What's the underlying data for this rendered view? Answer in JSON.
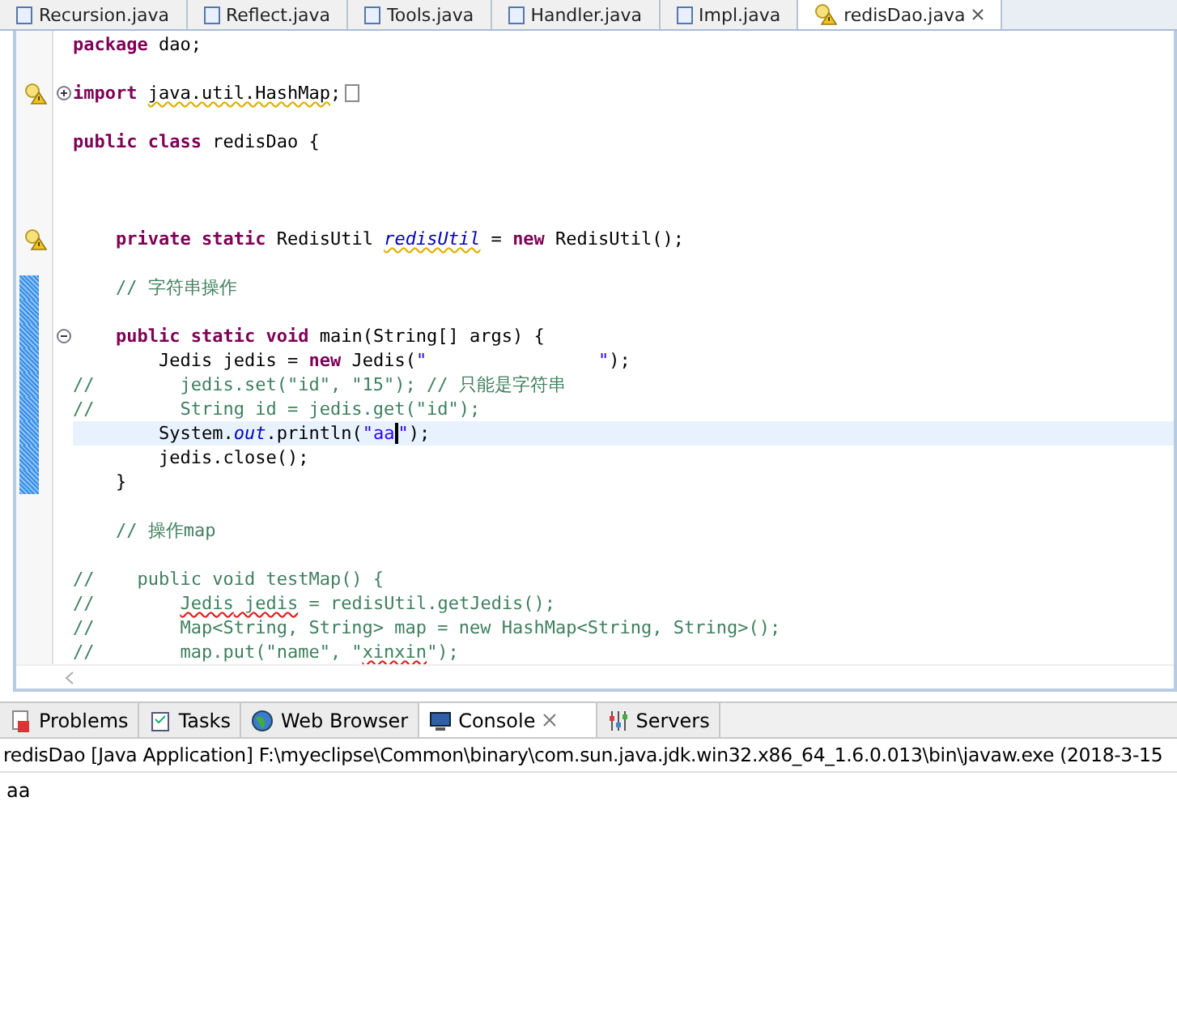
{
  "editor_tabs": [
    {
      "label": "Recursion.java",
      "selected": false,
      "warning": false
    },
    {
      "label": "Reflect.java",
      "selected": false,
      "warning": false
    },
    {
      "label": "Tools.java",
      "selected": false,
      "warning": false
    },
    {
      "label": "Handler.java",
      "selected": false,
      "warning": false
    },
    {
      "label": "Impl.java",
      "selected": false,
      "warning": false
    },
    {
      "label": "redisDao.java",
      "selected": true,
      "warning": true
    }
  ],
  "code_lines": [
    {
      "kind": "code",
      "tokens": [
        {
          "kind": "keyword",
          "text": "package"
        },
        {
          "kind": "plain",
          "text": " dao;"
        }
      ]
    },
    {
      "kind": "blank"
    },
    {
      "kind": "code",
      "warning": true,
      "fold_expanded": false,
      "tokens": [
        {
          "kind": "keyword",
          "text": "import "
        },
        {
          "kind": "plain",
          "text": "java.util.HashMap",
          "warning_underline": true
        },
        {
          "kind": "plain",
          "text": ";"
        }
      ]
    },
    {
      "kind": "blank"
    },
    {
      "kind": "code",
      "tokens": [
        {
          "kind": "keyword",
          "text": "public class"
        },
        {
          "kind": "plain",
          "text": " redisDao {"
        }
      ]
    },
    {
      "kind": "blank"
    },
    {
      "kind": "blank"
    },
    {
      "kind": "blank"
    },
    {
      "kind": "code",
      "warning": true,
      "tokens": [
        {
          "kind": "keyword",
          "text": "    private static"
        },
        {
          "kind": "plain",
          "text": " RedisUtil "
        },
        {
          "kind": "field",
          "text": "redisUtil",
          "warning_underline": true
        },
        {
          "kind": "plain",
          "text": " = "
        },
        {
          "kind": "keyword",
          "text": "new"
        },
        {
          "kind": "plain",
          "text": " RedisUtil();"
        }
      ]
    },
    {
      "kind": "blank"
    },
    {
      "kind": "code",
      "changed": true,
      "tokens": [
        {
          "kind": "comment",
          "text": "    // 字符串操作"
        }
      ]
    },
    {
      "kind": "blank",
      "changed": true
    },
    {
      "kind": "code",
      "changed": true,
      "fold_expanded": true,
      "tokens": [
        {
          "kind": "keyword",
          "text": "    public static void"
        },
        {
          "kind": "plain",
          "text": " main(String[] args) {"
        }
      ]
    },
    {
      "kind": "code",
      "changed": true,
      "tokens": [
        {
          "kind": "plain",
          "text": "        Jedis jedis = "
        },
        {
          "kind": "keyword",
          "text": "new"
        },
        {
          "kind": "plain",
          "text": " Jedis("
        },
        {
          "kind": "string",
          "text": "\"                \""
        },
        {
          "kind": "plain",
          "text": ");"
        }
      ]
    },
    {
      "kind": "code",
      "changed": true,
      "tokens": [
        {
          "kind": "comment",
          "text": "//        jedis.set(\"id\", \"15\"); // 只能是字符串"
        }
      ]
    },
    {
      "kind": "code",
      "changed": true,
      "tokens": [
        {
          "kind": "comment",
          "text": "//        String id = jedis.get(\"id\");"
        }
      ]
    },
    {
      "kind": "code",
      "changed": true,
      "current": true,
      "tokens": [
        {
          "kind": "plain",
          "text": "        System."
        },
        {
          "kind": "field",
          "text": "out"
        },
        {
          "kind": "plain",
          "text": ".println("
        },
        {
          "kind": "string",
          "text": "\"aa"
        },
        {
          "kind": "caret"
        },
        {
          "kind": "string",
          "text": "\""
        },
        {
          "kind": "plain",
          "text": ");"
        }
      ]
    },
    {
      "kind": "code",
      "changed": true,
      "tokens": [
        {
          "kind": "plain",
          "text": "        jedis.close();"
        }
      ]
    },
    {
      "kind": "code",
      "changed": true,
      "tokens": [
        {
          "kind": "plain",
          "text": "    }"
        }
      ]
    },
    {
      "kind": "blank"
    },
    {
      "kind": "code",
      "tokens": [
        {
          "kind": "comment",
          "text": "    // 操作map"
        }
      ]
    },
    {
      "kind": "blank"
    },
    {
      "kind": "code",
      "tokens": [
        {
          "kind": "comment",
          "text": "//    public void testMap() {"
        }
      ]
    },
    {
      "kind": "code",
      "tokens": [
        {
          "kind": "comment",
          "text": "//        "
        },
        {
          "kind": "comment",
          "text": "Jedis",
          "error_underline": true
        },
        {
          "kind": "comment",
          "text": " jedis",
          "error_underline": true
        },
        {
          "kind": "comment",
          "text": " = redisUtil.getJedis();"
        }
      ]
    },
    {
      "kind": "code",
      "tokens": [
        {
          "kind": "comment",
          "text": "//        Map<String, String> map = new HashMap<String, String>();"
        }
      ]
    },
    {
      "kind": "code",
      "tokens": [
        {
          "kind": "comment",
          "text": "//        map.put(\"name\", \""
        },
        {
          "kind": "comment",
          "text": "xinxin",
          "error_underline": true
        },
        {
          "kind": "comment",
          "text": "\");"
        }
      ]
    }
  ],
  "views": [
    {
      "label": "Problems",
      "kind": "problems",
      "selected": false
    },
    {
      "label": "Tasks",
      "kind": "tasks",
      "selected": false
    },
    {
      "label": "Web Browser",
      "kind": "browser",
      "selected": false
    },
    {
      "label": "Console",
      "kind": "console",
      "selected": true
    },
    {
      "label": "Servers",
      "kind": "servers",
      "selected": false
    }
  ],
  "console": {
    "header": "redisDao [Java Application] F:\\myeclipse\\Common\\binary\\com.sun.java.jdk.win32.x86_64_1.6.0.013\\bin\\javaw.exe (2018-3-15",
    "output": "aa"
  }
}
